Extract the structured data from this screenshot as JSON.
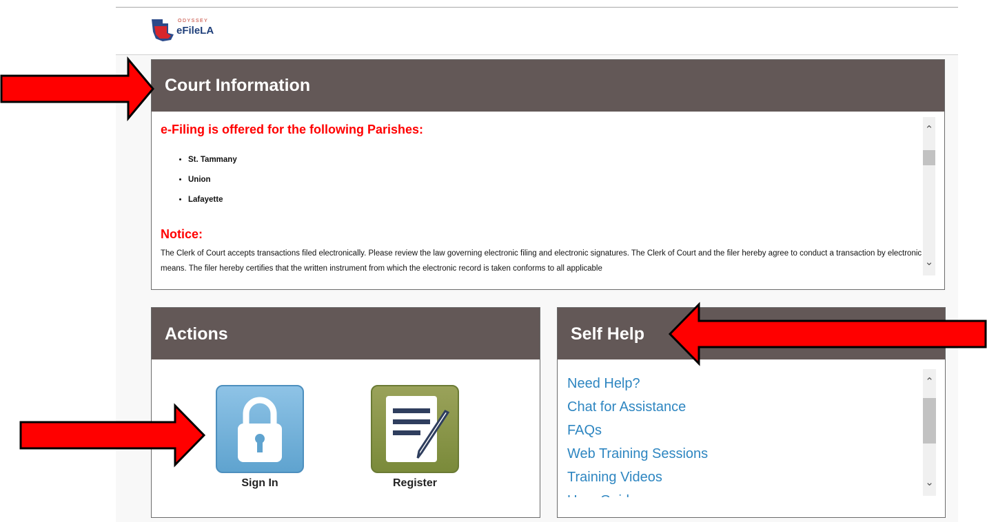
{
  "header": {
    "logo_small_text": "ODYSSEY",
    "logo_text": "eFileLA"
  },
  "court_information": {
    "title": "Court Information",
    "parishes_heading": "e-Filing is offered for the following Parishes:",
    "parishes": [
      "St. Tammany",
      "Union",
      "Lafayette"
    ],
    "notice_heading": "Notice:",
    "notice_text": "The Clerk of Court accepts transactions filed electronically. Please review the law governing electronic filing and electronic signatures. The Clerk of Court and the filer hereby agree to conduct a transaction by electronic means. The filer hereby certifies that the written instrument from which the electronic record is taken conforms to all applicable"
  },
  "actions": {
    "title": "Actions",
    "sign_in_label": "Sign In",
    "register_label": "Register",
    "sign_in_icon": "lock-icon",
    "register_icon": "document-edit-icon"
  },
  "self_help": {
    "title": "Self Help",
    "links": [
      "Need Help?",
      "Chat for Assistance",
      "FAQs",
      "Web Training Sessions",
      "Training Videos",
      "User Guides"
    ]
  },
  "colors": {
    "panel_header": "#635857",
    "notice_red": "#ff0000",
    "link_blue": "#2e86c1",
    "annotation_arrow": "#ff0000"
  }
}
